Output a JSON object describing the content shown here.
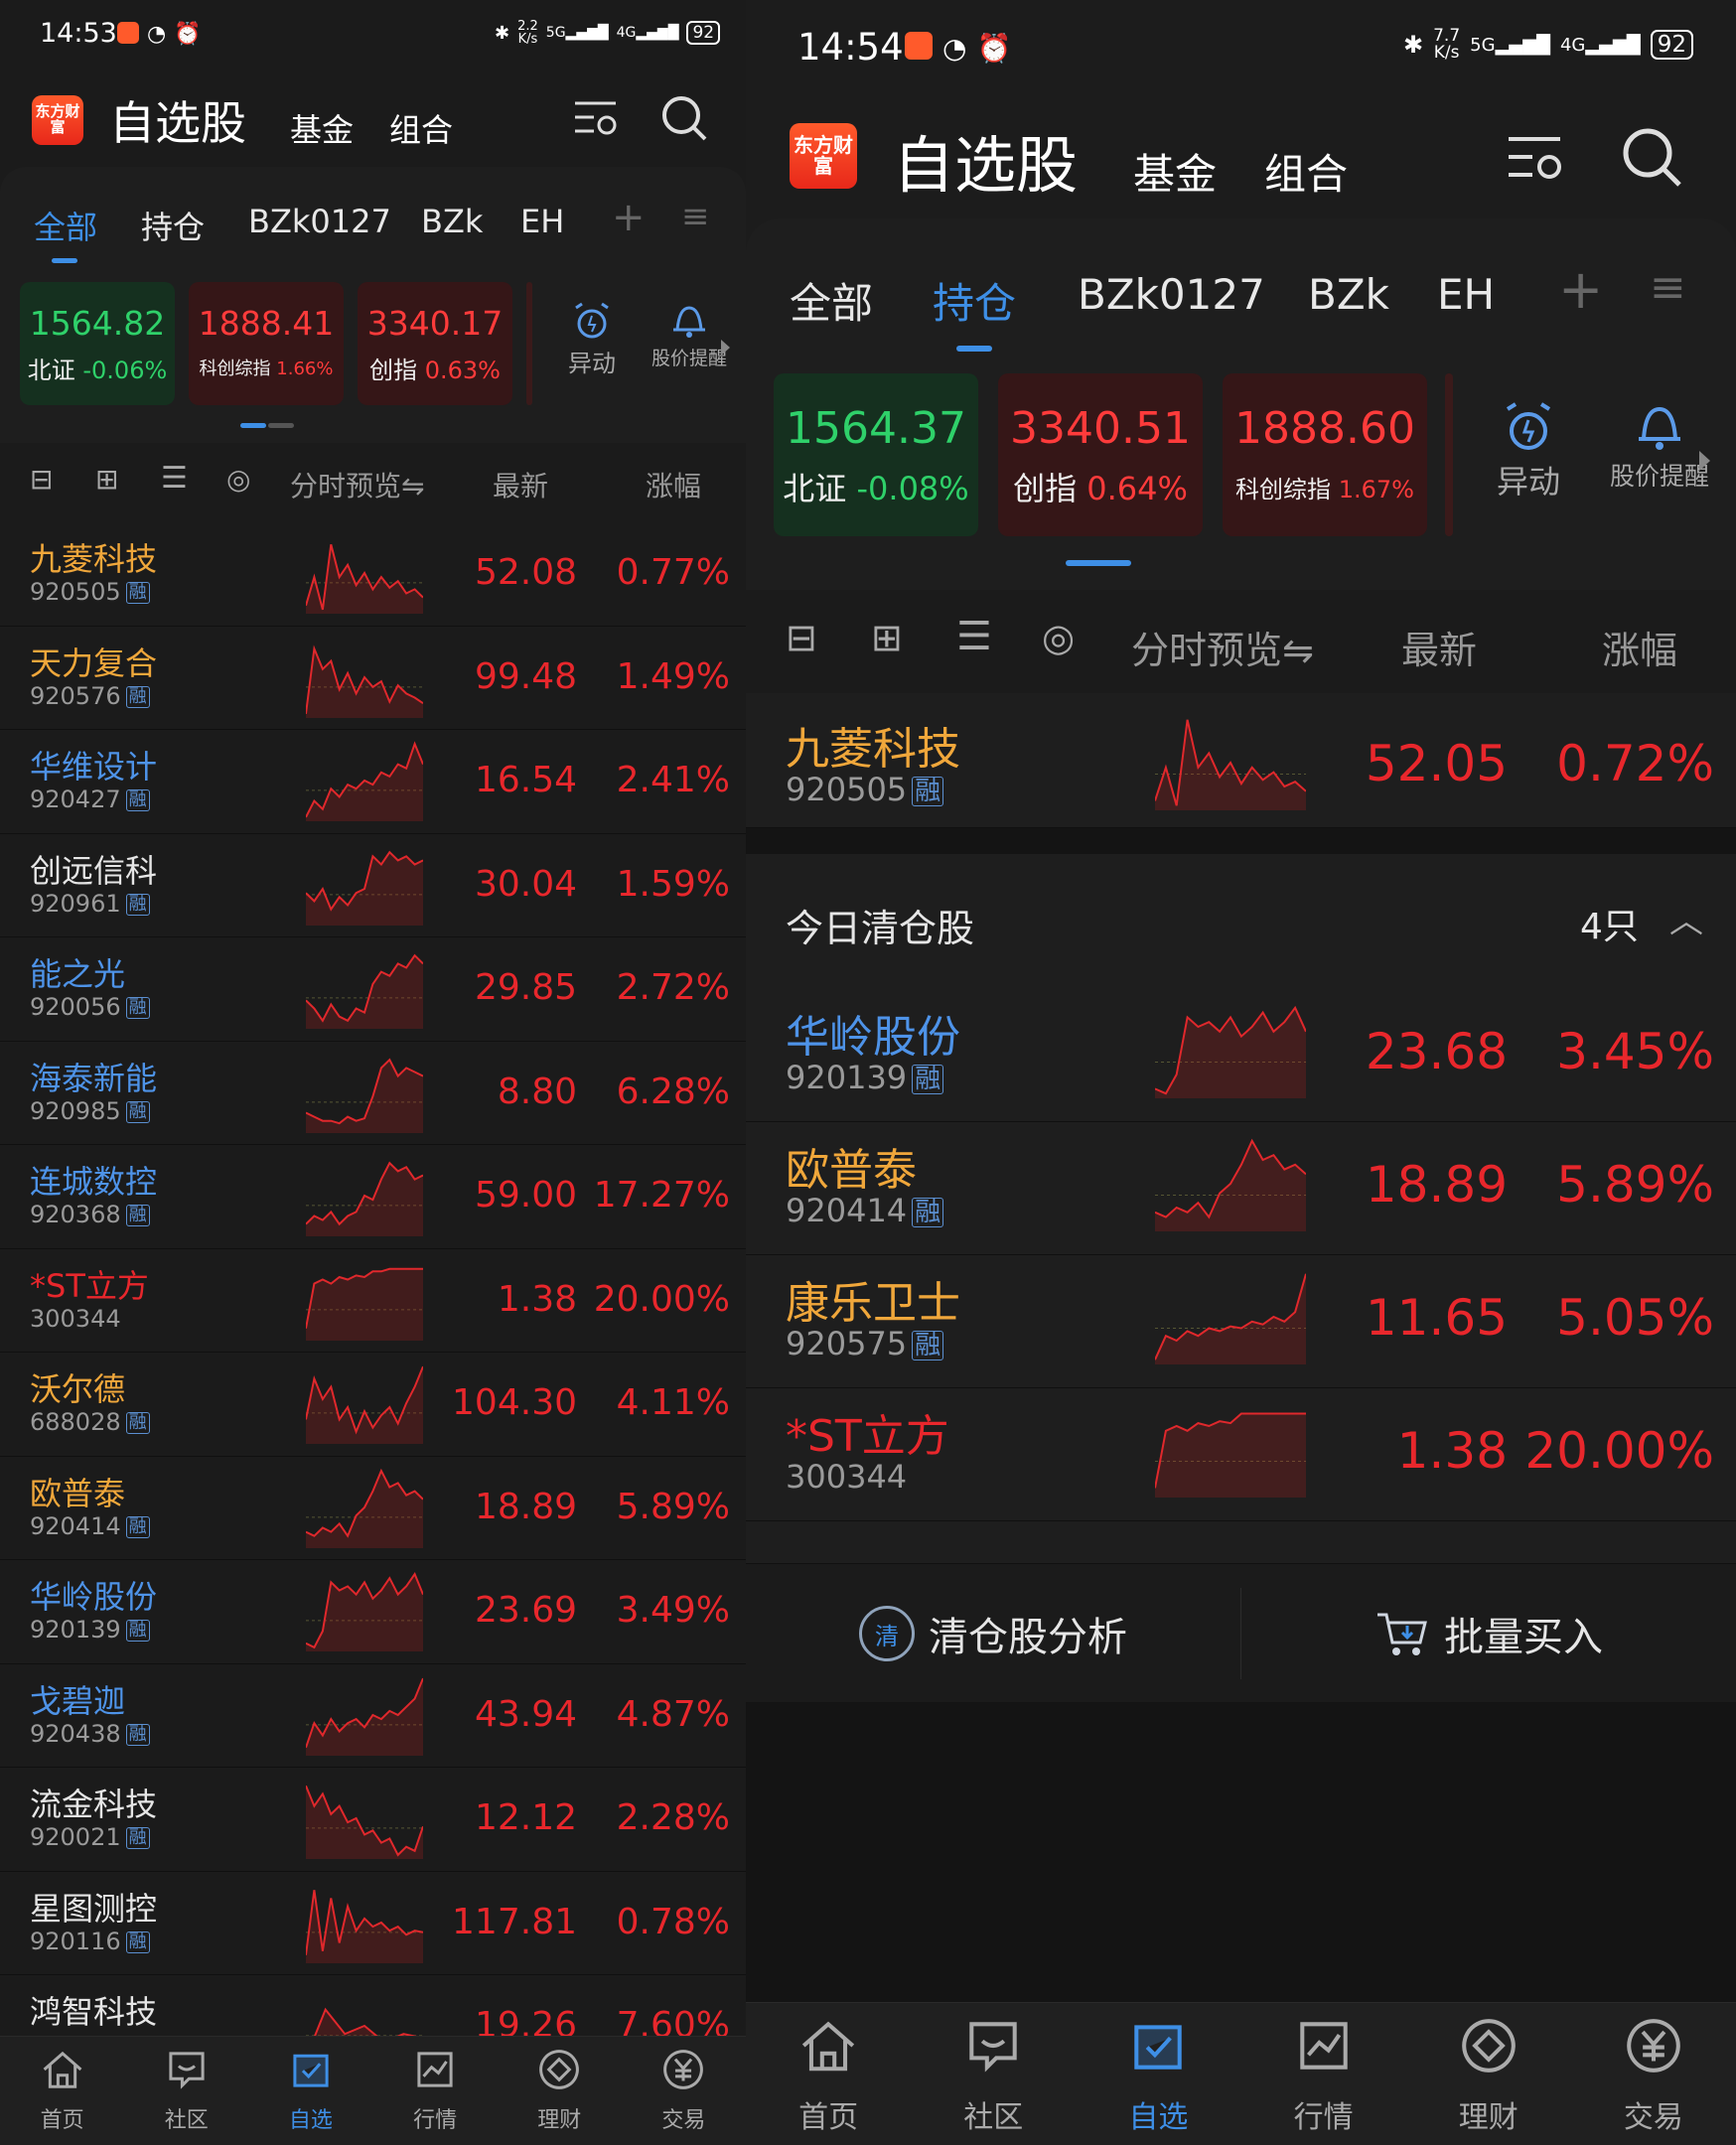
{
  "left": {
    "status": {
      "time": "14:53",
      "speed_top": "2.2",
      "speed_unit": "K/s",
      "net1": "5G",
      "net2": "4G",
      "battery": "92"
    },
    "header": {
      "logo": "东方财富",
      "title": "自选股",
      "fund": "基金",
      "combo": "组合",
      "filter_icon": "filter-settings-icon",
      "search_icon": "search-icon"
    },
    "tabs": [
      "全部",
      "持仓",
      "BZk0127",
      "BZk",
      "EH"
    ],
    "active_tab": 0,
    "indices": [
      {
        "value": "1564.82",
        "name": "北证",
        "pct": "-0.06%",
        "color": "green"
      },
      {
        "value": "1888.41",
        "name": "科创综指",
        "pct": "1.66%",
        "color": "red"
      },
      {
        "value": "3340.17",
        "name": "创指",
        "pct": "0.63%",
        "color": "red"
      }
    ],
    "quick": [
      {
        "label": "异动",
        "icon": "alarm-clock-icon"
      },
      {
        "label": "股价提醒",
        "icon": "bell-icon"
      }
    ],
    "columns": {
      "preview": "分时预览",
      "latest": "最新",
      "change": "涨幅"
    },
    "rows": [
      {
        "name": "九菱科技",
        "code": "920505",
        "rong": "融",
        "price": "52.08",
        "pct": "0.77%",
        "color": "gold",
        "spark": [
          0.9,
          0.55,
          0.95,
          0.15,
          0.55,
          0.4,
          0.65,
          0.5,
          0.7,
          0.55,
          0.68,
          0.6,
          0.75,
          0.7,
          0.8
        ]
      },
      {
        "name": "天力复合",
        "code": "920576",
        "rong": "融",
        "price": "99.48",
        "pct": "1.49%",
        "color": "gold",
        "spark": [
          0.95,
          0.15,
          0.4,
          0.3,
          0.65,
          0.45,
          0.7,
          0.5,
          0.62,
          0.55,
          0.8,
          0.6,
          0.7,
          0.75,
          0.82
        ]
      },
      {
        "name": "华维设计",
        "code": "920427",
        "rong": "融",
        "price": "16.54",
        "pct": "2.41%",
        "color": "blue",
        "spark": [
          0.95,
          0.75,
          0.85,
          0.6,
          0.7,
          0.55,
          0.6,
          0.5,
          0.55,
          0.4,
          0.45,
          0.3,
          0.35,
          0.05,
          0.3
        ]
      },
      {
        "name": "创远信科",
        "code": "920961",
        "rong": "融",
        "price": "30.04",
        "pct": "1.59%",
        "color": "white",
        "spark": [
          0.6,
          0.7,
          0.55,
          0.8,
          0.65,
          0.75,
          0.6,
          0.55,
          0.15,
          0.25,
          0.1,
          0.2,
          0.15,
          0.25,
          0.2
        ]
      },
      {
        "name": "能之光",
        "code": "920056",
        "rong": "融",
        "price": "29.85",
        "pct": "2.72%",
        "color": "blue",
        "spark": [
          0.65,
          0.75,
          0.9,
          0.7,
          0.85,
          0.9,
          0.75,
          0.8,
          0.45,
          0.3,
          0.35,
          0.2,
          0.25,
          0.1,
          0.2
        ]
      },
      {
        "name": "海泰新能",
        "code": "920985",
        "rong": "融",
        "price": "8.80",
        "pct": "6.28%",
        "color": "blue",
        "spark": [
          0.75,
          0.8,
          0.85,
          0.85,
          0.88,
          0.8,
          0.85,
          0.82,
          0.55,
          0.2,
          0.1,
          0.3,
          0.2,
          0.25,
          0.3
        ]
      },
      {
        "name": "连城数控",
        "code": "920368",
        "rong": "融",
        "price": "59.00",
        "pct": "17.27%",
        "color": "blue",
        "spark": [
          0.85,
          0.75,
          0.8,
          0.7,
          0.85,
          0.75,
          0.7,
          0.5,
          0.55,
          0.3,
          0.1,
          0.2,
          0.15,
          0.3,
          0.25
        ]
      },
      {
        "name": "*ST立方",
        "code": "300344",
        "rong": "",
        "price": "1.38",
        "pct": "20.00%",
        "color": "red",
        "spark": [
          0.85,
          0.3,
          0.25,
          0.3,
          0.22,
          0.25,
          0.2,
          0.22,
          0.15,
          0.15,
          0.12,
          0.12,
          0.12,
          0.12,
          0.12
        ]
      },
      {
        "name": "沃尔德",
        "code": "688028",
        "rong": "融",
        "price": "104.30",
        "pct": "4.11%",
        "color": "gold",
        "spark": [
          0.7,
          0.2,
          0.45,
          0.3,
          0.7,
          0.55,
          0.85,
          0.6,
          0.8,
          0.65,
          0.55,
          0.75,
          0.5,
          0.3,
          0.05
        ]
      },
      {
        "name": "欧普泰",
        "code": "920414",
        "rong": "融",
        "price": "18.89",
        "pct": "5.89%",
        "color": "gold",
        "spark": [
          0.8,
          0.85,
          0.75,
          0.8,
          0.7,
          0.85,
          0.6,
          0.5,
          0.3,
          0.05,
          0.25,
          0.2,
          0.35,
          0.3,
          0.4
        ]
      },
      {
        "name": "华岭股份",
        "code": "920139",
        "rong": "融",
        "price": "23.69",
        "pct": "3.49%",
        "color": "blue",
        "spark": [
          0.9,
          0.95,
          0.75,
          0.15,
          0.25,
          0.2,
          0.3,
          0.15,
          0.35,
          0.25,
          0.1,
          0.3,
          0.2,
          0.05,
          0.3
        ]
      },
      {
        "name": "戈碧迦",
        "code": "920438",
        "rong": "融",
        "price": "43.94",
        "pct": "4.87%",
        "color": "blue",
        "spark": [
          0.9,
          0.6,
          0.75,
          0.55,
          0.7,
          0.6,
          0.55,
          0.65,
          0.5,
          0.55,
          0.45,
          0.5,
          0.4,
          0.3,
          0.05
        ]
      },
      {
        "name": "流金科技",
        "code": "920021",
        "rong": "融",
        "price": "12.12",
        "pct": "2.28%",
        "color": "white",
        "spark": [
          0.1,
          0.35,
          0.2,
          0.45,
          0.35,
          0.55,
          0.5,
          0.7,
          0.65,
          0.8,
          0.75,
          0.95,
          0.85,
          0.9,
          0.6
        ]
      },
      {
        "name": "星图测控",
        "code": "920116",
        "rong": "融",
        "price": "117.81",
        "pct": "0.78%",
        "color": "white",
        "spark": [
          0.9,
          0.1,
          0.85,
          0.2,
          0.75,
          0.3,
          0.6,
          0.45,
          0.55,
          0.5,
          0.6,
          0.55,
          0.65,
          0.6,
          0.62
        ]
      },
      {
        "name": "鸿智科技",
        "code": "",
        "rong": "",
        "price": "19.26",
        "pct": "7.60%",
        "color": "white",
        "spark": [
          0.9,
          0.3,
          0.6,
          0.5,
          0.7,
          0.6,
          0.65
        ]
      }
    ],
    "nav": [
      {
        "label": "首页",
        "icon": "home-icon"
      },
      {
        "label": "社区",
        "icon": "community-icon"
      },
      {
        "label": "自选",
        "icon": "watchlist-icon"
      },
      {
        "label": "行情",
        "icon": "market-icon"
      },
      {
        "label": "理财",
        "icon": "finance-icon"
      },
      {
        "label": "交易",
        "icon": "trade-icon"
      }
    ],
    "active_nav": 2
  },
  "right": {
    "status": {
      "time": "14:54",
      "speed_top": "7.7",
      "speed_unit": "K/s",
      "net1": "5G",
      "net2": "4G",
      "battery": "92"
    },
    "header": {
      "logo": "东方财富",
      "title": "自选股",
      "fund": "基金",
      "combo": "组合"
    },
    "tabs": [
      "全部",
      "持仓",
      "BZk0127",
      "BZk",
      "EH"
    ],
    "active_tab": 1,
    "indices": [
      {
        "value": "1564.37",
        "name": "北证",
        "pct": "-0.08%",
        "color": "green"
      },
      {
        "value": "3340.51",
        "name": "创指",
        "pct": "0.64%",
        "color": "red"
      },
      {
        "value": "1888.60",
        "name": "科创综指",
        "pct": "1.67%",
        "color": "red"
      }
    ],
    "quick": [
      {
        "label": "异动",
        "icon": "alarm-clock-icon"
      },
      {
        "label": "股价提醒",
        "icon": "bell-icon"
      }
    ],
    "columns": {
      "preview": "分时预览",
      "latest": "最新",
      "change": "涨幅"
    },
    "holding": [
      {
        "name": "九菱科技",
        "code": "920505",
        "rong": "融",
        "price": "52.05",
        "pct": "0.72%",
        "color": "gold",
        "spark": [
          0.9,
          0.55,
          0.95,
          0.05,
          0.55,
          0.4,
          0.65,
          0.5,
          0.72,
          0.55,
          0.68,
          0.6,
          0.75,
          0.7,
          0.8
        ]
      }
    ],
    "cleared": {
      "title": "今日清仓股",
      "count": "4只",
      "rows": [
        {
          "name": "华岭股份",
          "code": "920139",
          "rong": "融",
          "price": "23.68",
          "pct": "3.45%",
          "color": "blue",
          "spark": [
            0.9,
            0.95,
            0.75,
            0.15,
            0.25,
            0.2,
            0.3,
            0.15,
            0.35,
            0.25,
            0.1,
            0.3,
            0.2,
            0.05,
            0.3
          ]
        },
        {
          "name": "欧普泰",
          "code": "920414",
          "rong": "融",
          "price": "18.89",
          "pct": "5.89%",
          "color": "gold",
          "spark": [
            0.8,
            0.85,
            0.75,
            0.8,
            0.7,
            0.85,
            0.6,
            0.5,
            0.3,
            0.05,
            0.25,
            0.2,
            0.35,
            0.3,
            0.4
          ]
        },
        {
          "name": "康乐卫士",
          "code": "920575",
          "rong": "融",
          "price": "11.65",
          "pct": "5.05%",
          "color": "gold",
          "spark": [
            0.95,
            0.7,
            0.75,
            0.65,
            0.7,
            0.62,
            0.65,
            0.6,
            0.62,
            0.55,
            0.58,
            0.5,
            0.55,
            0.45,
            0.05
          ]
        },
        {
          "name": "*ST立方",
          "code": "300344",
          "rong": "",
          "price": "1.38",
          "pct": "20.00%",
          "color": "red",
          "spark": [
            0.9,
            0.3,
            0.25,
            0.3,
            0.22,
            0.25,
            0.2,
            0.22,
            0.12,
            0.12,
            0.12,
            0.12,
            0.12,
            0.12,
            0.12
          ]
        }
      ]
    },
    "actions": [
      {
        "label": "清仓股分析",
        "icon": "clearance-analysis-icon"
      },
      {
        "label": "批量买入",
        "icon": "cart-icon"
      }
    ],
    "nav": [
      {
        "label": "首页",
        "icon": "home-icon"
      },
      {
        "label": "社区",
        "icon": "community-icon"
      },
      {
        "label": "自选",
        "icon": "watchlist-icon"
      },
      {
        "label": "行情",
        "icon": "market-icon"
      },
      {
        "label": "理财",
        "icon": "finance-icon"
      },
      {
        "label": "交易",
        "icon": "trade-icon"
      }
    ],
    "active_nav": 2
  }
}
